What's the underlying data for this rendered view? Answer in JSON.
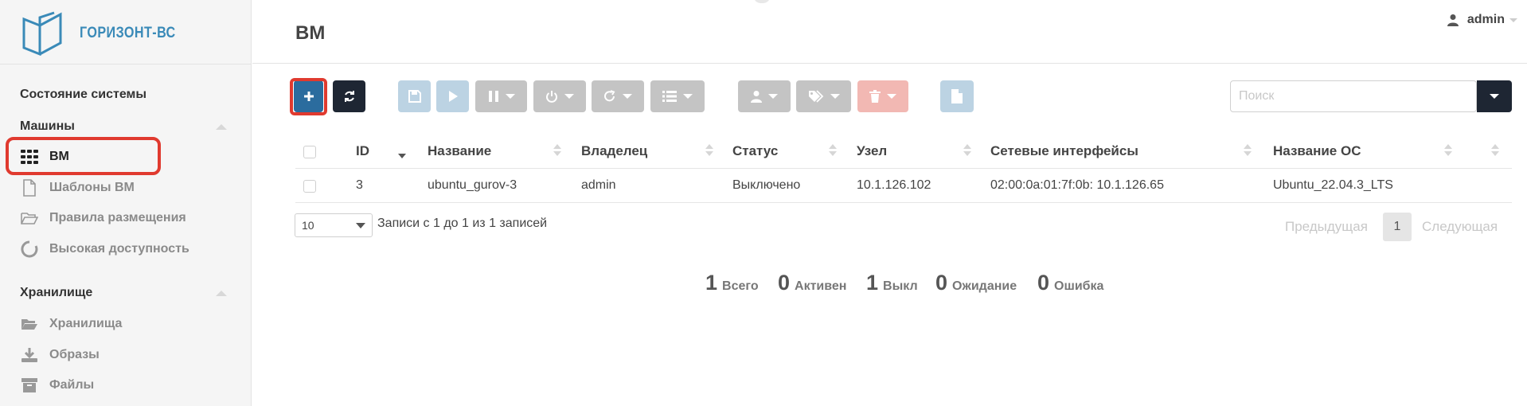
{
  "app": {
    "logo_text": "ГОРИЗОНТ-ВС"
  },
  "header": {
    "title": "ВМ",
    "user_name": "admin"
  },
  "sidebar": {
    "system_state": "Состояние системы",
    "machines_group": "Машины",
    "machines_items": [
      {
        "label": "ВМ",
        "icon": "grid-icon",
        "active": true
      },
      {
        "label": "Шаблоны ВМ",
        "icon": "file-icon",
        "active": false
      },
      {
        "label": "Правила размещения",
        "icon": "folder-open-icon",
        "active": false
      },
      {
        "label": "Высокая доступность",
        "icon": "circle-icon",
        "active": false
      }
    ],
    "storage_group": "Хранилище",
    "storage_items": [
      {
        "label": "Хранилища",
        "icon": "folder-icon"
      },
      {
        "label": "Образы",
        "icon": "download-icon"
      },
      {
        "label": "Файлы",
        "icon": "archive-icon"
      }
    ]
  },
  "search": {
    "placeholder": "Поиск"
  },
  "table": {
    "columns": [
      "ID",
      "Название",
      "Владелец",
      "Статус",
      "Узел",
      "Сетевые интерфейсы",
      "Название ОС"
    ],
    "rows": [
      {
        "id": "3",
        "name": "ubuntu_gurov-3",
        "owner": "admin",
        "status": "Выключено",
        "host": "10.1.126.102",
        "nics": "02:00:0a:01:7f:0b: 10.1.126.65",
        "os": "Ubuntu_22.04.3_LTS"
      }
    ]
  },
  "footer": {
    "page_size": "10",
    "records_info": "Записи с 1 до 1 из 1 записей",
    "prev": "Предыдущая",
    "page": "1",
    "next": "Следующая"
  },
  "stats": [
    {
      "num": "1",
      "label": "Всего"
    },
    {
      "num": "0",
      "label": "Активен"
    },
    {
      "num": "1",
      "label": "Выкл"
    },
    {
      "num": "0",
      "label": "Ожидание"
    },
    {
      "num": "0",
      "label": "Ошибка"
    }
  ],
  "colors": {
    "primary": "#2b6c9e",
    "dark": "#1e2633",
    "highlight": "#e03a2f",
    "logo": "#3a8ab8"
  }
}
